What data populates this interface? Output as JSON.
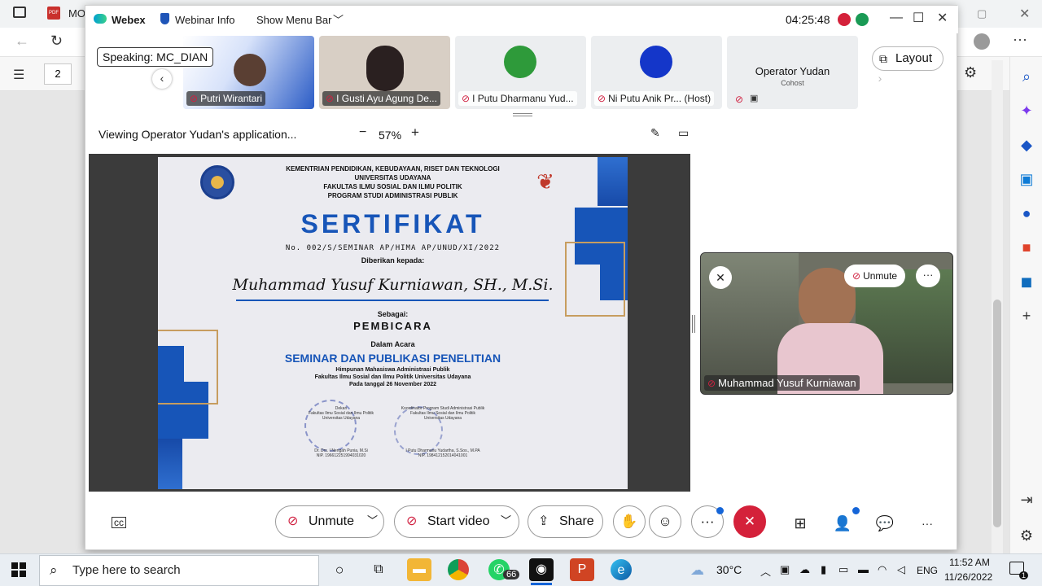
{
  "browser": {
    "tab_title": "MO",
    "page_number": "2"
  },
  "webex": {
    "app_name": "Webex",
    "webinar_info": "Webinar Info",
    "show_menu_bar": "Show Menu Bar",
    "clock": "04:25:48",
    "speaking_label": "Speaking:",
    "speaking_name": "MC_DIAN",
    "layout_label": "Layout",
    "participants": [
      {
        "name": "Putri Wirantari"
      },
      {
        "name": "I Gusti Ayu Agung De..."
      },
      {
        "name": "I Putu Dharmanu Yud..."
      },
      {
        "name": "Ni Putu Anik Pr... (Host)"
      },
      {
        "name": "Operator Yudan",
        "role": "Cohost"
      }
    ],
    "viewing_text": "Viewing Operator Yudan's application...",
    "zoom": "57%",
    "self_view": {
      "unmute_label": "Unmute",
      "name": "Muhammad Yusuf Kurniawan"
    },
    "controls": {
      "unmute": "Unmute",
      "start_video": "Start video",
      "share": "Share"
    }
  },
  "certificate": {
    "header_lines": [
      "KEMENTRIAN PENDIDIKAN, KEBUDAYAAN, RISET DAN TEKNOLOGI",
      "UNIVERSITAS UDAYANA",
      "FAKULTAS ILMU SOSIAL DAN ILMU POLITIK",
      "PROGRAM STUDI ADMINISTRASI PUBLIK"
    ],
    "title": "SERTIFIKAT",
    "number": "No. 002/S/SEMINAR AP/HIMA AP/UNUD/XI/2022",
    "given_to": "Diberikan kepada:",
    "recipient": "Muhammad Yusuf Kurniawan, SH., M.Si.",
    "as_label": "Sebagai:",
    "role": "PEMBICARA",
    "event_label": "Dalam Acara",
    "event": "SEMINAR DAN PUBLIKASI PENELITIAN",
    "organizer_lines": [
      "Himpunan Mahasiswa Administrasi Publik",
      "Fakultas Ilmu Sosial dan Ilmu Politik Universitas Udayana",
      "Pada tanggal 26 November 2022"
    ],
    "sign_left": [
      "Dekan",
      "Fakultas Ilmu Sosial dan Ilmu Politik",
      "Universitas Udayana",
      "Dr. Drs. I Nengah Punia, M.Si",
      "NIP. 196612251994031020"
    ],
    "sign_right": [
      "Koordinator Program Studi Administrasi Publik",
      "Fakultas Ilmu Sosial dan Ilmu Politik",
      "Universitas Udayana",
      "I Putu Dharmanu Yudartha, S.Sos., M.PA",
      "NIP. 198412152014041001"
    ]
  },
  "taskbar": {
    "search_placeholder": "Type here to search",
    "whatsapp_badge": "66",
    "weather": "30°C",
    "language": "ENG",
    "time": "11:52 AM",
    "date": "11/26/2022",
    "notification_count": "1"
  },
  "colors": {
    "accent": "#1755b8",
    "end_red": "#d4213a",
    "gold": "#c79d5f"
  }
}
